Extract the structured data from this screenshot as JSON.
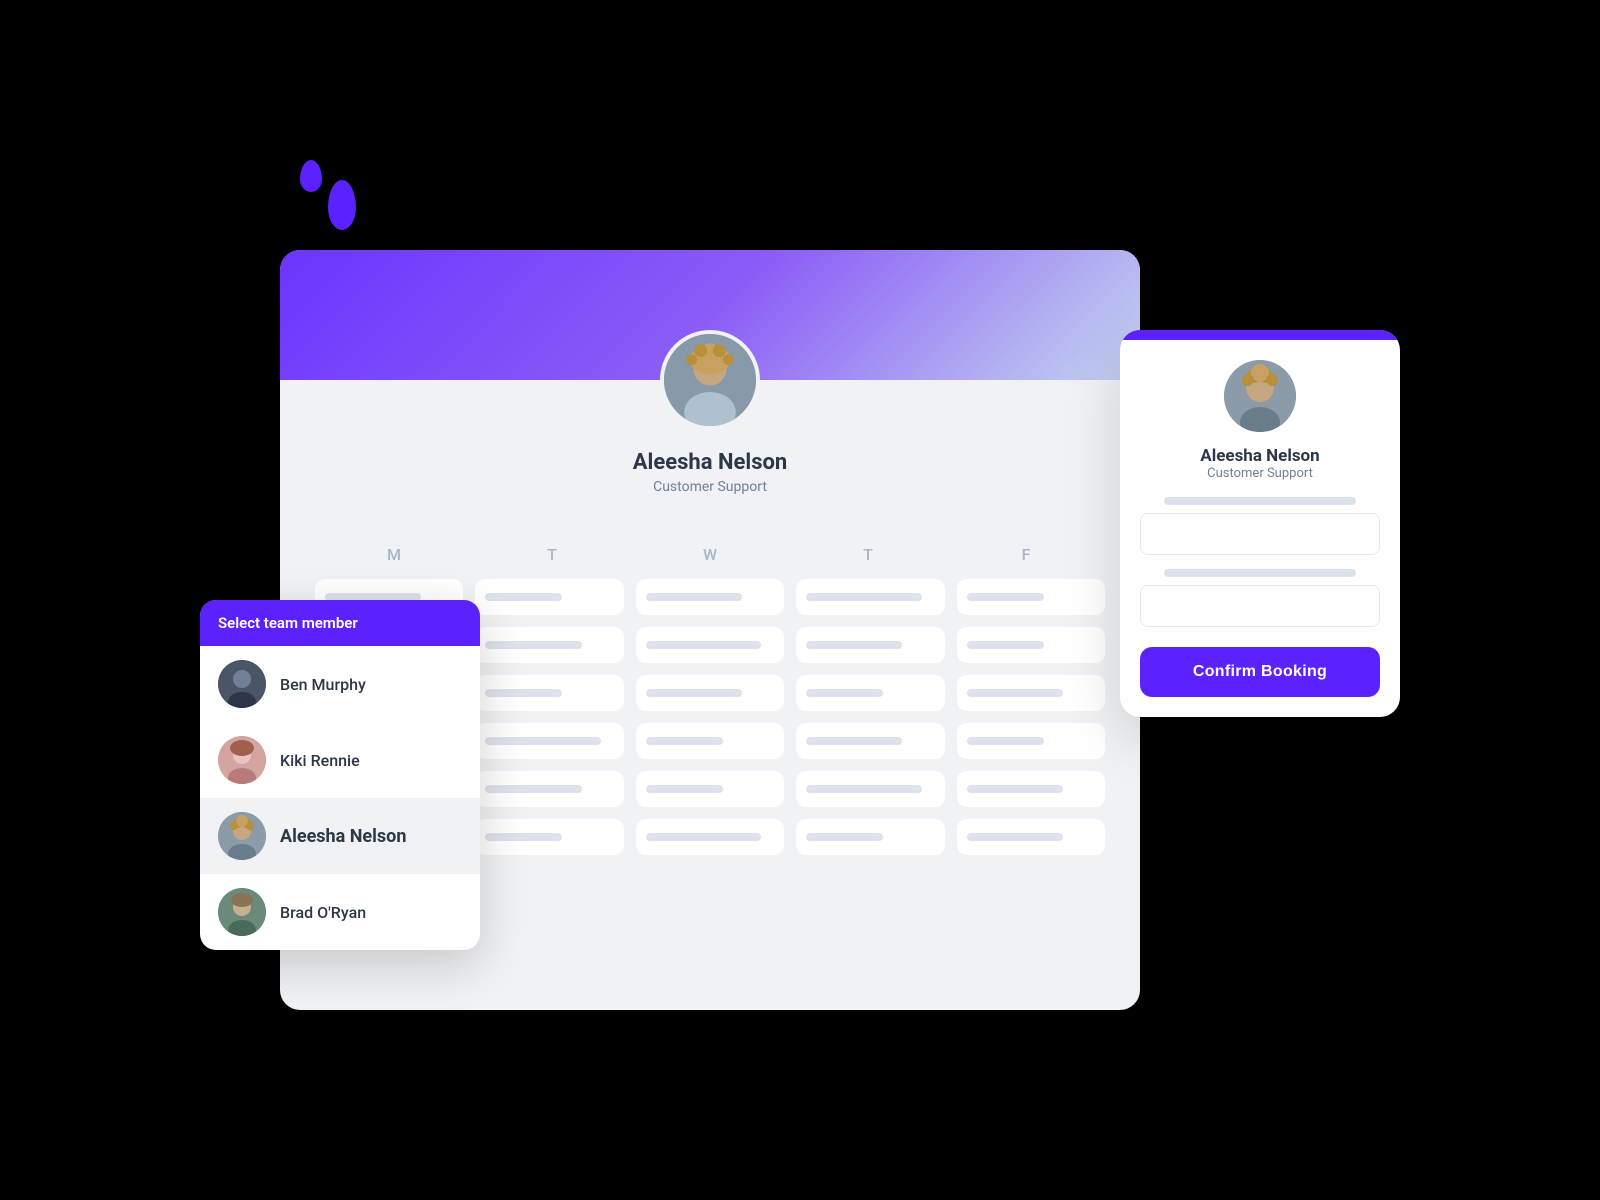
{
  "scene": {
    "background": "#000000"
  },
  "profile": {
    "name": "Aleesha Nelson",
    "role": "Customer Support"
  },
  "calendar": {
    "days": [
      "M",
      "T",
      "W",
      "T",
      "F"
    ],
    "rows": 6
  },
  "dropdown": {
    "header": "Select team member",
    "members": [
      {
        "id": "ben",
        "name": "Ben Murphy",
        "selected": false
      },
      {
        "id": "kiki",
        "name": "Kiki Rennie",
        "selected": false
      },
      {
        "id": "aleesha",
        "name": "Aleesha Nelson",
        "selected": true
      },
      {
        "id": "brad",
        "name": "Brad O'Ryan",
        "selected": false
      }
    ]
  },
  "booking_card": {
    "name": "Aleesha Nelson",
    "role": "Customer Support",
    "confirm_label": "Confirm Booking"
  }
}
